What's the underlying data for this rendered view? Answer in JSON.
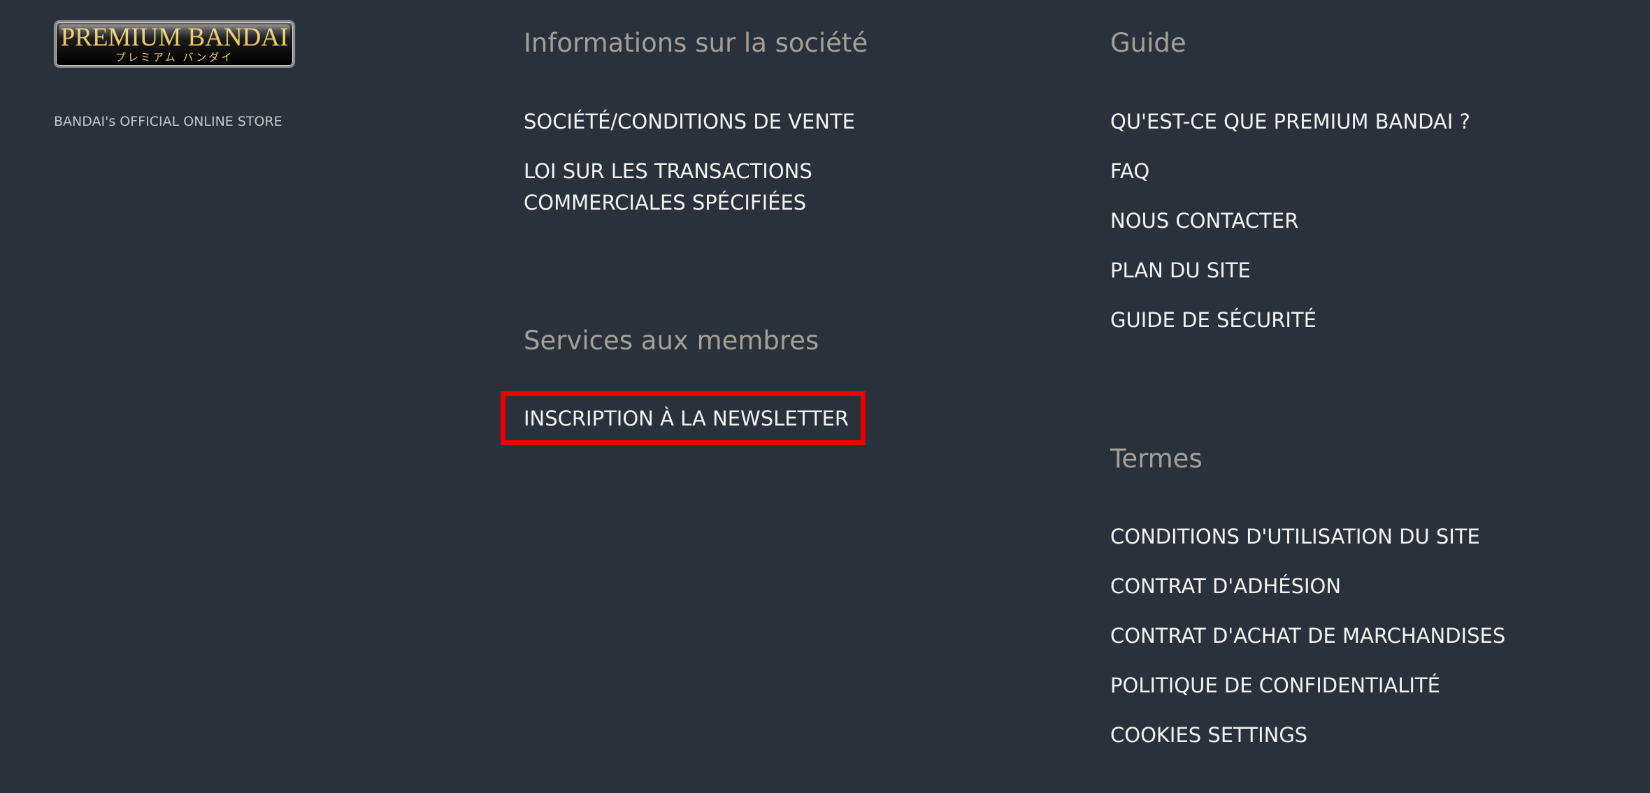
{
  "brand": {
    "logo_main": "PREMIUM BANDAI",
    "logo_sub": "プレミアム バンダイ",
    "tagline": "BANDAI's OFFICIAL ONLINE STORE"
  },
  "company": {
    "heading": "Informations sur la société",
    "links": [
      "SOCIÉTÉ/CONDITIONS DE VENTE",
      "LOI SUR LES TRANSACTIONS COMMERCIALES SPÉCIFIÉES"
    ]
  },
  "members": {
    "heading": "Services aux membres",
    "links": [
      "INSCRIPTION À LA NEWSLETTER"
    ]
  },
  "guide": {
    "heading": "Guide",
    "links": [
      "QU'EST-CE QUE PREMIUM BANDAI ?",
      "FAQ",
      "NOUS CONTACTER",
      "PLAN DU SITE",
      "GUIDE DE SÉCURITÉ"
    ]
  },
  "terms": {
    "heading": "Termes",
    "links": [
      "CONDITIONS D'UTILISATION DU SITE",
      "CONTRAT D'ADHÉSION",
      "CONTRAT D'ACHAT DE MARCHANDISES",
      "POLITIQUE DE CONFIDENTIALITÉ",
      "COOKIES SETTINGS"
    ]
  },
  "colors": {
    "background": "#29323c",
    "heading": "#a59f95",
    "link": "#f2f2f2",
    "highlight": "#ee0000",
    "logo_gold": "#e8c970"
  }
}
